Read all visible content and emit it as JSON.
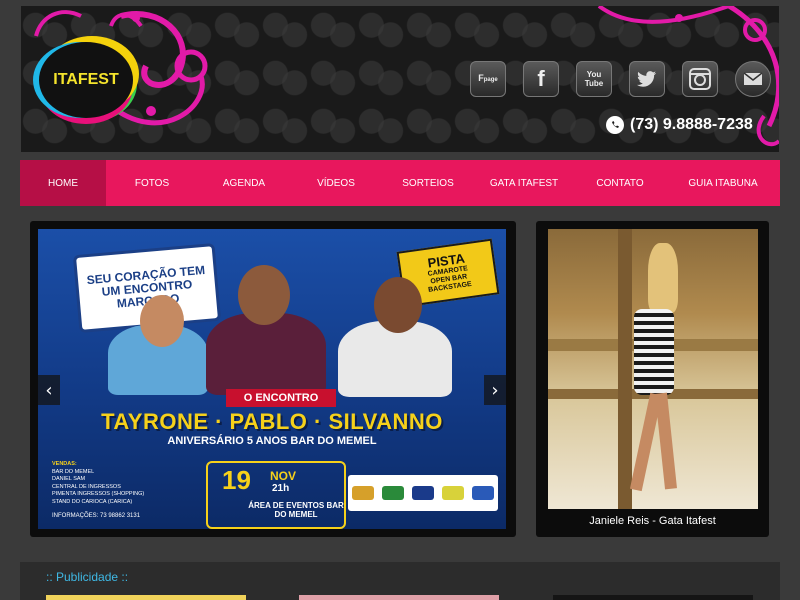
{
  "header": {
    "logo_text": "ITAFEST",
    "social": [
      {
        "name": "facebook-page",
        "label": "Fpage"
      },
      {
        "name": "facebook",
        "label": "f"
      },
      {
        "name": "youtube",
        "label": "YouTube"
      },
      {
        "name": "twitter",
        "label": "twitter-bird"
      },
      {
        "name": "instagram",
        "label": "camera"
      },
      {
        "name": "email",
        "label": "envelope"
      }
    ],
    "phone": "(73) 9.8888-7238"
  },
  "nav": {
    "items": [
      "HOME",
      "FOTOS",
      "AGENDA",
      "VÍDEOS",
      "SORTEIOS",
      "GATA ITAFEST",
      "CONTATO",
      "GUIA ITABUNA"
    ],
    "active": "HOME"
  },
  "slider": {
    "bubble_text": "SEU CORAÇÃO TEM UM ENCONTRO MARCADO",
    "pista_title": "PISTA",
    "pista_lines": [
      "CAMAROTE",
      "OPEN BAR",
      "BACKSTAGE"
    ],
    "encontro": "O ENCONTRO",
    "artists": "TAYRONE · PABLO · SILVANNO",
    "anniversary": "ANIVERSÁRIO 5 ANOS BAR DO MEMEL",
    "vendas_title": "VENDAS:",
    "vendas": [
      "BAR DO MEMEL",
      "DANIEL SAM",
      "CENTRAL DE INGRESSOS",
      "PIMENTA INGRESSOS (SHOPPING)",
      "STAND DO CARIOCA (CARICA)"
    ],
    "info": "INFORMAÇÕES:  73 98862 3131",
    "date_day": "19",
    "date_month": "NOV",
    "date_hour": "21h",
    "venue": "ÁREA DE EVENTOS BAR DO MEMEL",
    "prev_arrow": "‹",
    "next_arrow": "›"
  },
  "gata": {
    "caption": "Janiele Reis - Gata Itafest"
  },
  "publicidade": {
    "title": ":: Publicidade ::"
  },
  "colors": {
    "nav": "#e8175d",
    "nav_active": "#b60f46",
    "accent_blue": "#3fb9e5",
    "flyer_yellow": "#f6d11a"
  }
}
